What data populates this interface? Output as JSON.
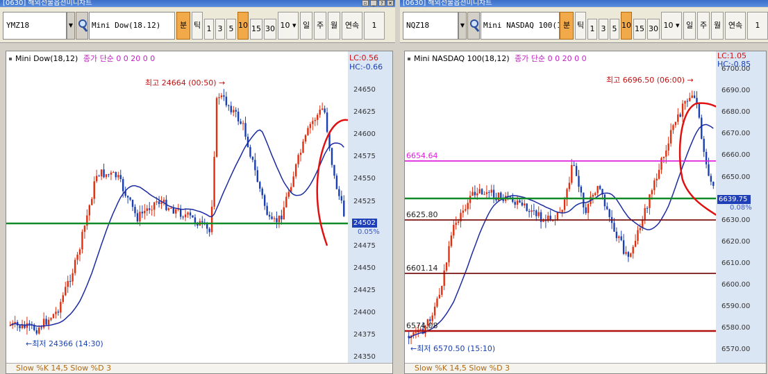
{
  "left": {
    "title": "[0630] 해외선물옵션미니차트",
    "symbol": "YMZ18",
    "name": "Mini Dow(18.12)",
    "buttons": [
      "분",
      "틱",
      "1",
      "3",
      "5",
      "10",
      "15",
      "30",
      "10",
      "일",
      "주",
      "월",
      "연속",
      "1"
    ],
    "chart_label": "Mini Dow(18,12)",
    "legend": "종가 단순 0 0 20 0 0",
    "lc": "LC:0.56",
    "hc": "HC:-0.66",
    "high_label": "최고 24664 (00:50)",
    "low_label": "최저 24366 (14:30)",
    "current_price": "24502",
    "current_pct": "0.05%",
    "bottom_text": "Slow %K 14,5  Slow %D 3",
    "axis_ticks": [
      "24650",
      "24625",
      "24600",
      "24575",
      "24550",
      "24525",
      "24500",
      "24475",
      "24450",
      "24425",
      "24400",
      "24375",
      "24350"
    ]
  },
  "right": {
    "title": "[0630] 해외선물옵션미니차트",
    "symbol": "NQZ18",
    "name": "Mini NASDAQ 100(18",
    "buttons": [
      "분",
      "틱",
      "1",
      "3",
      "5",
      "10",
      "15",
      "30",
      "10",
      "일",
      "주",
      "월",
      "연속",
      "1"
    ],
    "chart_label": "Mini NASDAQ 100(18,12)",
    "legend": "종가 단순 0 0 20 0 0",
    "lc": "LC:1.05",
    "hc": "HC:-0.85",
    "high_label": "최고 6696.50 (06:00)",
    "low_label": "최저 6570.50 (15:10)",
    "current_price": "6639.75",
    "current_pct": "0.08%",
    "bottom_text": "Slow %K 14,5  Slow %D 3",
    "axis_ticks": [
      "6700.00",
      "6690.00",
      "6680.00",
      "6670.00",
      "6660.00",
      "6650.00",
      "6640.00",
      "6630.00",
      "6620.00",
      "6610.00",
      "6600.00",
      "6590.00",
      "6580.00",
      "6570.00"
    ],
    "levels": [
      {
        "label": "6654.64",
        "color": "#e020e0"
      },
      {
        "label": "6625.80",
        "color": "#7a1010"
      },
      {
        "label": "6601.14",
        "color": "#7a1010"
      },
      {
        "label": "6574.08",
        "color": "#b01010"
      }
    ]
  },
  "colors": {
    "up": "#e03010",
    "down": "#1a3fb0",
    "ma": "#1a2aa0",
    "support": "#128a28",
    "ink": "#e01010"
  },
  "chart_data": [
    {
      "type": "candlestick",
      "title": "Mini Dow(18,12)",
      "ylim": [
        24350,
        24675
      ],
      "ma_period": 20,
      "horizontal_lines": [
        24502
      ],
      "annotations": [
        "최고 24664 (00:50)",
        "최저 24366 (14:30)"
      ]
    },
    {
      "type": "candlestick",
      "title": "Mini NASDAQ 100(18,12)",
      "ylim": [
        6565,
        6705
      ],
      "ma_period": 20,
      "horizontal_lines": [
        6654.64,
        6625.8,
        6601.14,
        6574.08,
        6639.75
      ],
      "annotations": [
        "최고 6696.50 (06:00)",
        "최저 6570.50 (15:10)"
      ]
    }
  ]
}
